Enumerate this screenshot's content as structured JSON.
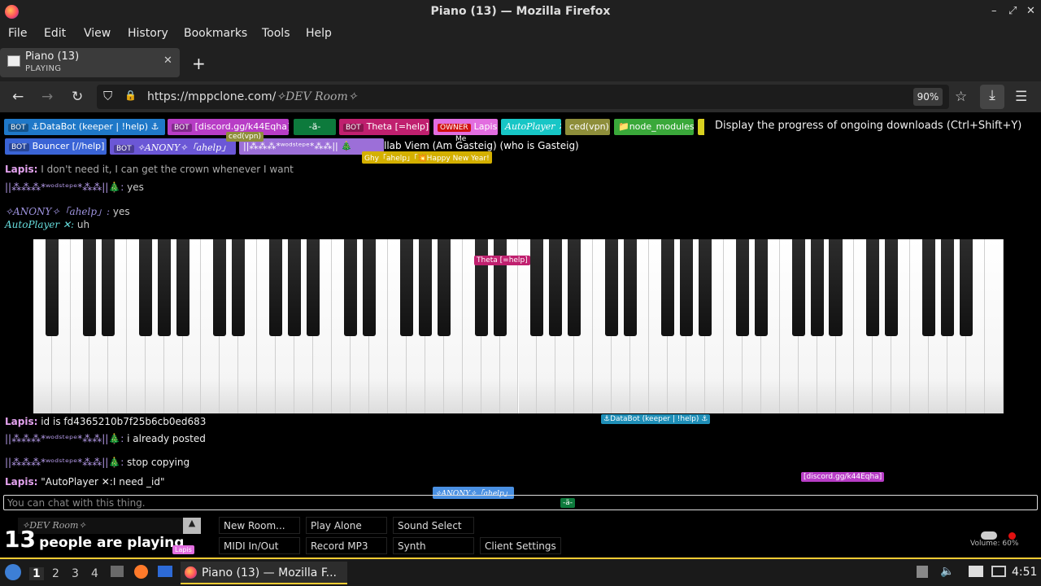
{
  "window": {
    "title": "Piano (13) — Mozilla Firefox",
    "controls": {
      "min": "–",
      "max": "⤢",
      "close": "✕"
    }
  },
  "menu": [
    "File",
    "Edit",
    "View",
    "History",
    "Bookmarks",
    "Tools",
    "Help"
  ],
  "tab": {
    "title": "Piano (13)",
    "subtitle": "PLAYING",
    "close": "✕",
    "new": "+"
  },
  "nav": {
    "back": "←",
    "forward": "→",
    "reload": "↻",
    "shield": "⛉",
    "lock": "🔒",
    "url_host": "https://mppclone.com/",
    "url_path": "✧DEV Room✧",
    "zoom": "90%",
    "bookmark": "☆",
    "download": "⤓",
    "menu": "☰"
  },
  "tooltip": "Display the progress of ongoing downloads (Ctrl+Shift+Y)",
  "players": [
    {
      "tag": "BOT",
      "name": "⚓DataBot (keeper | !help) ⚓",
      "color": "#1f78c8"
    },
    {
      "tag": "BOT",
      "name": "[discord.gg/k44Eqha]",
      "color": "#b83dc6"
    },
    {
      "tag": "",
      "name": "-ä-",
      "color": "#0d7a3c"
    },
    {
      "tag": "BOT",
      "name": "Theta [=help]",
      "color": "#c0206f"
    },
    {
      "tag": "OWNER",
      "name": "Lapis",
      "color": "#e26de0"
    },
    {
      "tag": "",
      "name": "AutoPlayer ✕",
      "color": "#17c6c6"
    },
    {
      "tag": "",
      "name": "ced(vpn)",
      "color": "#8e8e3a"
    },
    {
      "tag": "",
      "name": "📁node_modules",
      "color": "#3aa83a"
    },
    {
      "tag": "BOT",
      "name": "Bouncer [//help]",
      "color": "#3a64d6"
    },
    {
      "tag": "BOT",
      "name": "✧ANONY✧「ahelp」",
      "color": "#6b57d6"
    },
    {
      "tag": "",
      "name": "||⁂⁂⁂*ʷᵒᵈˢᵗᵉᵖᵉ*⁂⁂|| 🎄",
      "color": "#9c6fd8"
    }
  ],
  "overlay_texts": {
    "ced": "ced(vpn)",
    "me": "Me",
    "gasteig": "llab Viem (Am Gasteig) (who is Gasteig)",
    "newyear": "Ghy「ahelp」「💥Happy New Year!"
  },
  "chat": [
    {
      "name": "Lapis:",
      "text": "I don't need it, I can get the crown whenever I want",
      "color": "#e4a3f0"
    },
    {
      "name": "||⁂⁂⁂*ʷᵒᵈˢᵗᵉᵖᵉ*⁂⁂||🎄:",
      "text": "yes",
      "color": "#b49ae8"
    },
    {
      "name": "✧ANONY✧「ahelp」:",
      "text": "yes",
      "color": "#9f94e0"
    },
    {
      "name": "AutoPlayer ✕:",
      "text": "uh",
      "color": "#66dddd"
    },
    {
      "name": "Lapis:",
      "text": "id is fd4365210b7f25b6cb0ed683",
      "color": "#e4a3f0"
    },
    {
      "name": "||⁂⁂⁂*ʷᵒᵈˢᵗᵉᵖᵉ*⁂⁂||🎄:",
      "text": "i already posted",
      "color": "#b49ae8"
    },
    {
      "name": "||⁂⁂⁂*ʷᵒᵈˢᵗᵉᵖᵉ*⁂⁂||🎄:",
      "text": "stop copying",
      "color": "#b49ae8"
    },
    {
      "name": "Lapis:",
      "text": "\"AutoPlayer ✕:I need _id\"",
      "color": "#e4a3f0"
    }
  ],
  "cursor_labels": {
    "theta": "Theta [=help]",
    "databot": "⚓DataBot (keeper | !help) ⚓",
    "anony": "✧ANONY✧「ahelp」",
    "discord": "[discord.gg/k44Eqha]",
    "ae": "-ä-",
    "lapis": "Lapis"
  },
  "chat_placeholder": "You can chat with this thing.",
  "room": {
    "name": "✧DEV Room✧",
    "caret": "▲"
  },
  "buttons": {
    "new_room": "New Room...",
    "play_alone": "Play Alone",
    "sound_select": "Sound Select",
    "midi": "MIDI In/Out",
    "record": "Record MP3",
    "synth": "Synth",
    "client_settings": "Client Settings"
  },
  "people": {
    "count": "13",
    "text": "people are playing"
  },
  "volume": "Volume: 60%",
  "taskbar": {
    "workspaces": [
      "1",
      "2",
      "3",
      "4"
    ],
    "app": "Piano (13) — Mozilla F...",
    "clock": "4:51"
  }
}
